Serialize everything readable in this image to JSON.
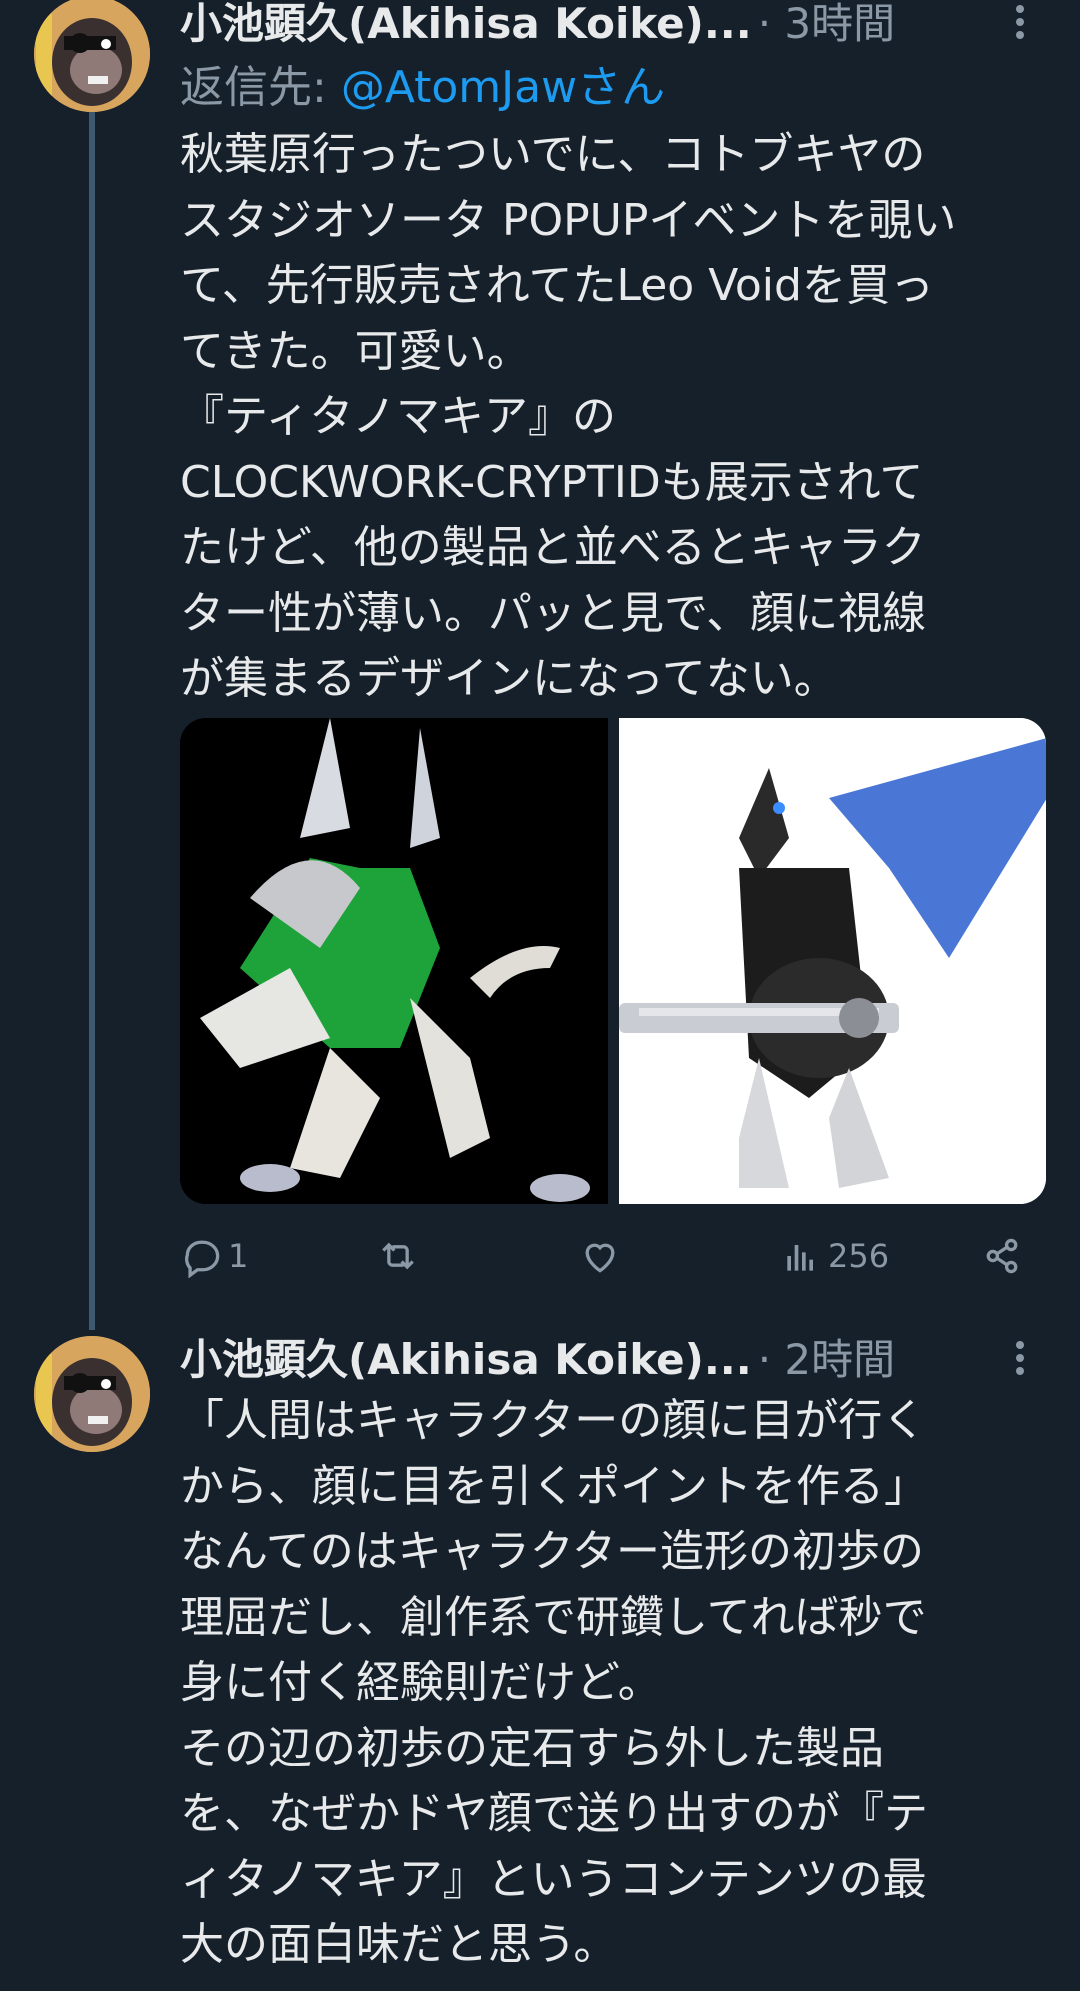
{
  "tweets": [
    {
      "author": "小池顕久(Akihisa Koike)...",
      "time": "· 3時間",
      "reply_prefix": "返信先: ",
      "reply_handle": "@AtomJawさん",
      "text": "秋葉原行ったついでに、コトブキヤの\nスタジオソータ POPUPイベントを覗い\nて、先行販売されてたLeo Voidを買っ\nてきた。可愛い。\n『ティタノマキア』の\nCLOCKWORK-CRYPTIDも展示されて\nたけど、他の製品と並べるとキャラク\nター性が薄い。パッと見で、顔に視線\nが集まるデザインになってない。",
      "actions": {
        "replies": "1",
        "views": "256"
      }
    },
    {
      "author": "小池顕久(Akihisa Koike)...",
      "time": "· 2時間",
      "text": "「人間はキャラクターの顔に目が行く\nから、顔に目を引くポイントを作る」\nなんてのはキャラクター造形の初歩の\n理屈だし、創作系で研鑽してれば秒で\n身に付く経験則だけど。\nその辺の初歩の定石すら外した製品\nを、なぜかドヤ顔で送り出すのが『テ\nィタノマキア』というコンテンツの最\n大の面白味だと思う。"
    }
  ],
  "colors": {
    "background": "#15202b",
    "text": "#e7e9ea",
    "muted": "#8b98a5",
    "link": "#1d9bf0"
  },
  "icons": [
    "more-vertical-icon",
    "reply-icon",
    "retweet-icon",
    "like-icon",
    "views-icon",
    "share-icon"
  ]
}
